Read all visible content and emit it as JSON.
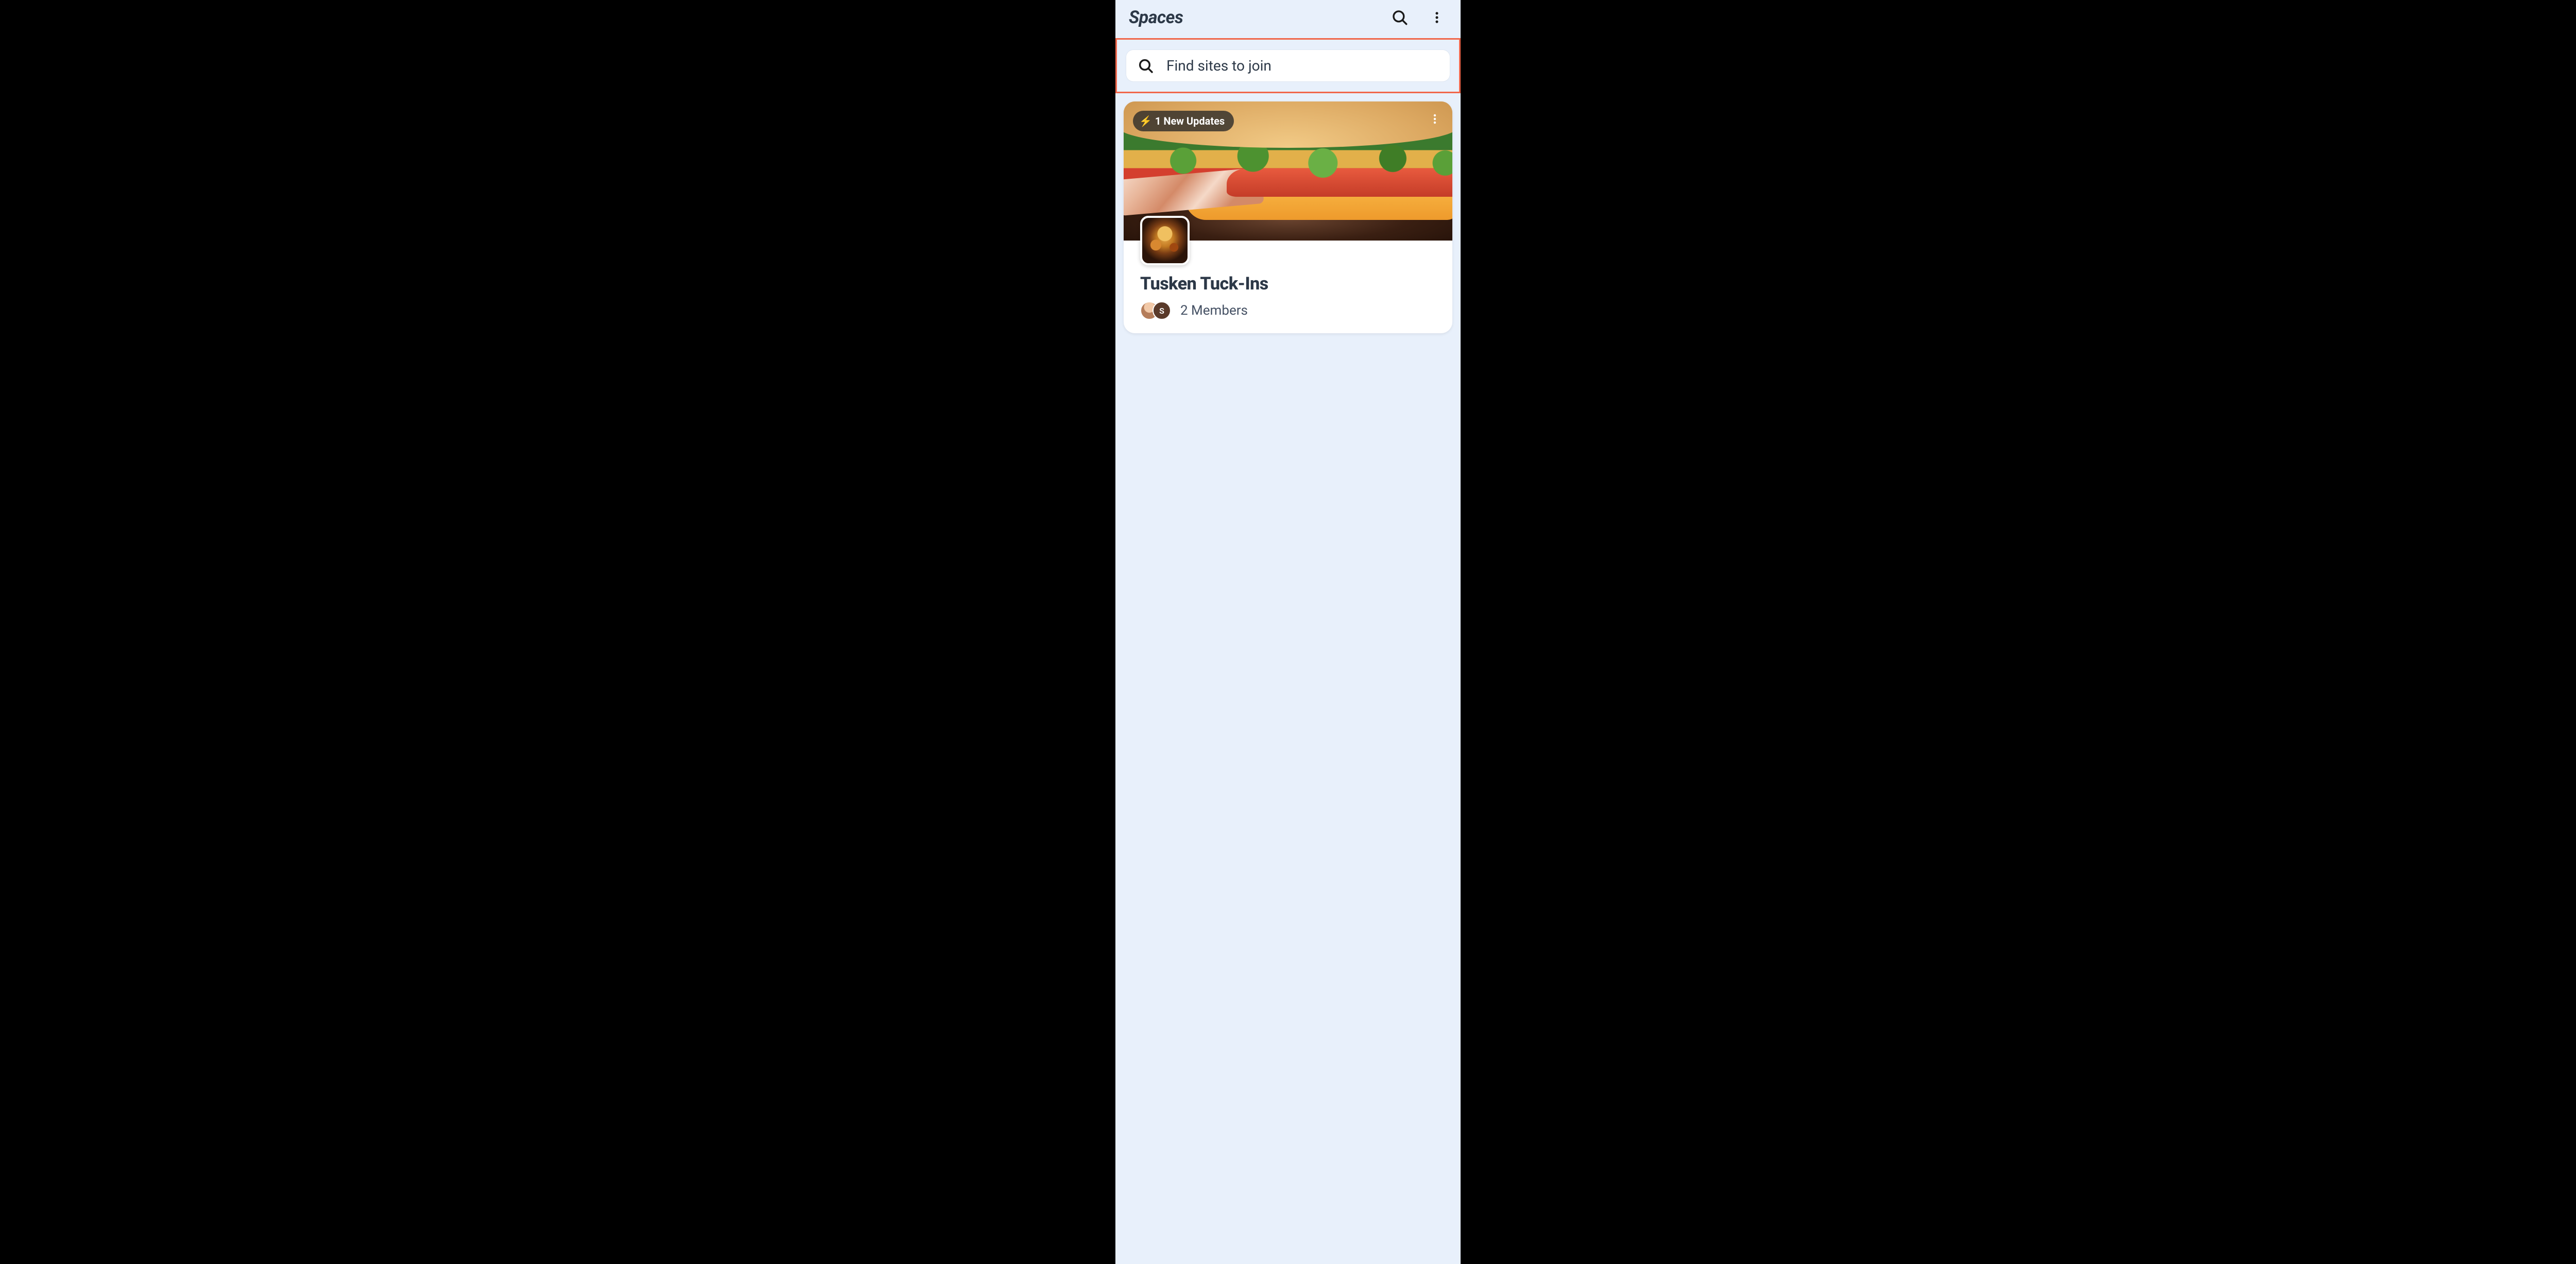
{
  "header": {
    "title": "Spaces"
  },
  "search": {
    "placeholder": "Find sites to join"
  },
  "card": {
    "updates_badge": "1 New Updates",
    "title": "Tusken Tuck-Ins",
    "members_text": "2 Members",
    "avatar2_initial": "S"
  },
  "highlight_color": "#f0674a"
}
